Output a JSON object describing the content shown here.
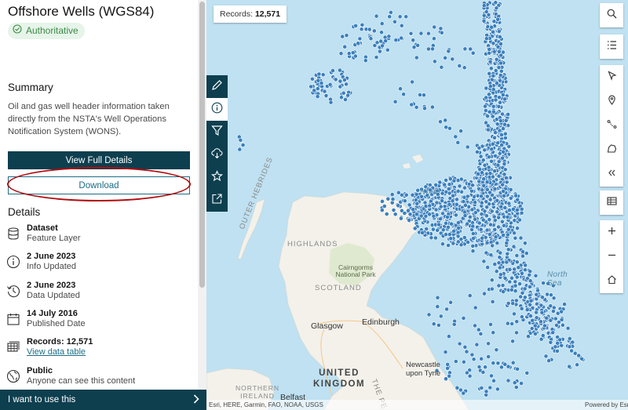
{
  "item": {
    "title": "Offshore Wells (WGS84)",
    "badge": "Authoritative"
  },
  "summary": {
    "heading": "Summary",
    "text": "Oil and gas well header information taken directly from the NSTA's Well Operations Notification System (WONS)."
  },
  "buttons": {
    "view_details": "View Full Details",
    "download": "Download"
  },
  "details": {
    "heading": "Details",
    "items": [
      {
        "icon": "layers-icon",
        "main": "Dataset",
        "sub": "Feature Layer"
      },
      {
        "icon": "info-icon",
        "main": "2 June 2023",
        "sub": "Info Updated"
      },
      {
        "icon": "history-icon",
        "main": "2 June 2023",
        "sub": "Data Updated"
      },
      {
        "icon": "calendar-icon",
        "main": "14 July 2016",
        "sub": "Published Date"
      },
      {
        "icon": "table-icon",
        "main": "Records: 12,571",
        "sub": "View data table"
      },
      {
        "icon": "globe-icon",
        "main": "Public",
        "sub": "Anyone can see this content"
      }
    ]
  },
  "footer": {
    "label": "I want to use this"
  },
  "map": {
    "records_label": "Records:",
    "records_value": "12,571",
    "labels": {
      "outer_hebrides": "OUTER HEBRIDES",
      "highlands": "HIGHLANDS",
      "cairngorms": "Cairngorms National Park",
      "scotland": "SCOTLAND",
      "glasgow": "Glasgow",
      "edinburgh": "Edinburgh",
      "newcastle": "Newcastle upon Tyne",
      "united_kingdom": "UNITED KINGDOM",
      "northern_ireland": "NORTHERN IRELAND",
      "belfast": "Belfast",
      "north_sea": "North Sea",
      "the_pe": "THE PE",
      "north": "North"
    },
    "attribution_left": "Esri, HERE, Garmin, FAO, NOAA, USGS",
    "attribution_right": "Powered by Esri"
  },
  "colors": {
    "brand_dark": "#0d3f4f",
    "link": "#1b6d85",
    "well_dot": "#3a7fbd",
    "annotation": "#b10c10",
    "sea": "#bfe1f1",
    "land": "#f3f1ea"
  }
}
